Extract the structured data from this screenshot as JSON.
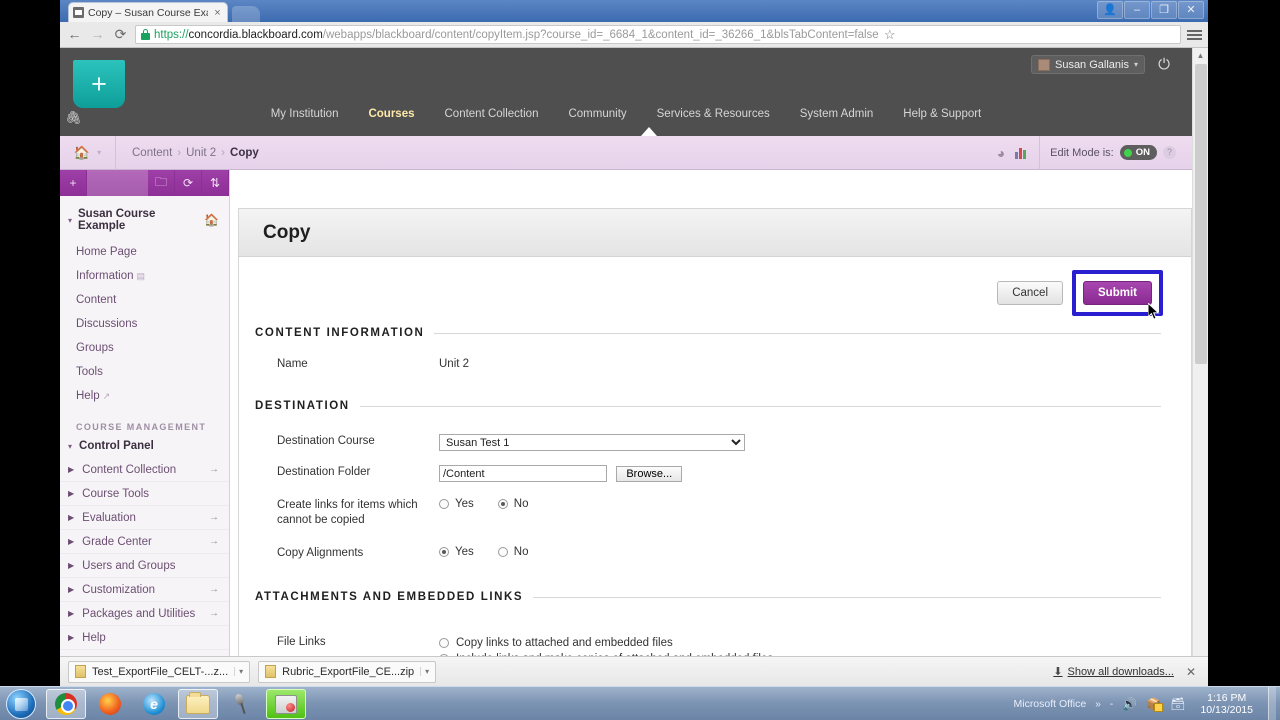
{
  "browser": {
    "tab": {
      "title": "Copy – Susan Course Exa",
      "close_label": "×",
      "favicon": "blackboard-favicon"
    },
    "window_controls": {
      "minimize": "–",
      "maximize": "❐",
      "close": "✕",
      "user": "👤"
    },
    "nav": {
      "back": "←",
      "forward": "→",
      "reload": "⟳"
    },
    "url": {
      "scheme": "https://",
      "host": "concordia.blackboard.com",
      "path": "/webapps/blackboard/content/copyItem.jsp?course_id=_6684_1&content_id=_36266_1&blsTabContent=false",
      "secure_label": "Secure"
    },
    "bookmark_star": "☆",
    "menu": "hamburger-menu"
  },
  "blackboard": {
    "logo_glyph": "+",
    "clip_glyph": "🖇",
    "user": {
      "name": "Susan Gallanis",
      "caret": "▾"
    },
    "power": "⏻",
    "nav_items": [
      {
        "label": "My Institution",
        "active": false
      },
      {
        "label": "Courses",
        "active": true
      },
      {
        "label": "Content Collection",
        "active": false
      },
      {
        "label": "Community",
        "active": false
      },
      {
        "label": "Services & Resources",
        "active": false
      },
      {
        "label": "System Admin",
        "active": false
      },
      {
        "label": "Help & Support",
        "active": false
      }
    ]
  },
  "breadcrumb": {
    "home_icon": "🏠",
    "home_caret": "▾",
    "items": [
      {
        "label": "Content",
        "current": false
      },
      {
        "label": "Unit 2",
        "current": false
      },
      {
        "label": "Copy",
        "current": true
      }
    ],
    "separator": "›",
    "edit_mode_label": "Edit Mode is:",
    "edit_mode_value": "ON",
    "help_glyph": "?"
  },
  "sidebar": {
    "toolbar": [
      {
        "name": "add-item",
        "glyph": "+"
      },
      {
        "name": "list-view",
        "glyph": "🗀"
      },
      {
        "name": "refresh",
        "glyph": "⟳"
      },
      {
        "name": "reorder",
        "glyph": "⇅"
      }
    ],
    "course_title": "Susan Course Example",
    "twisty": "▾",
    "home_glyph": "🏠",
    "links": [
      {
        "label": "Home Page",
        "ext": ""
      },
      {
        "label": "Information",
        "ext": "▤"
      },
      {
        "label": "Content",
        "ext": ""
      },
      {
        "label": "Discussions",
        "ext": ""
      },
      {
        "label": "Groups",
        "ext": ""
      },
      {
        "label": "Tools",
        "ext": ""
      },
      {
        "label": "Help",
        "ext": "↗"
      }
    ],
    "section_label": "COURSE MANAGEMENT",
    "control_panel_label": "Control Panel",
    "control_panel_items": [
      {
        "label": "Content Collection",
        "arrow": "→"
      },
      {
        "label": "Course Tools",
        "arrow": ""
      },
      {
        "label": "Evaluation",
        "arrow": "→"
      },
      {
        "label": "Grade Center",
        "arrow": "→"
      },
      {
        "label": "Users and Groups",
        "arrow": ""
      },
      {
        "label": "Customization",
        "arrow": "→"
      },
      {
        "label": "Packages and Utilities",
        "arrow": "→"
      },
      {
        "label": "Help",
        "arrow": ""
      }
    ],
    "item_twisty": "▶"
  },
  "page": {
    "title": "Copy",
    "cancel_label": "Cancel",
    "submit_label": "Submit",
    "highlight_color": "#2a1fd0",
    "sections": {
      "content_information": {
        "heading": "CONTENT INFORMATION",
        "name_label": "Name",
        "name_value": "Unit 2"
      },
      "destination": {
        "heading": "DESTINATION",
        "course_label": "Destination Course",
        "course_value": "Susan Test 1",
        "course_options": [
          "Susan Test 1"
        ],
        "folder_label": "Destination Folder",
        "folder_value": "/Content",
        "browse_label": "Browse...",
        "create_links_label": "Create links for items which cannot be copied",
        "create_links_yes": "Yes",
        "create_links_no": "No",
        "create_links_selected": "No",
        "copy_alignments_label": "Copy Alignments",
        "copy_alignments_yes": "Yes",
        "copy_alignments_no": "No",
        "copy_alignments_selected": "Yes"
      },
      "attachments": {
        "heading": "ATTACHMENTS AND EMBEDDED LINKS",
        "file_links_label": "File Links",
        "option_1": "Copy links to attached and embedded files",
        "option_2": "Include links and make copies of attached and embedded files",
        "selected": "option_2"
      }
    }
  },
  "downloads": {
    "items": [
      {
        "name": "Test_ExportFile_CELT-...z...",
        "caret": "▾"
      },
      {
        "name": "Rubric_ExportFile_CE...zip",
        "caret": "▾"
      }
    ],
    "show_all_label": "Show all downloads...",
    "show_all_icon": "⬇",
    "close_label": "✕"
  },
  "taskbar": {
    "start_label": "start-orb",
    "apps": [
      {
        "name": "chrome",
        "state": "active"
      },
      {
        "name": "firefox",
        "state": "normal"
      },
      {
        "name": "internet-explorer",
        "state": "normal"
      },
      {
        "name": "file-explorer",
        "state": "active"
      },
      {
        "name": "microphone",
        "state": "normal"
      },
      {
        "name": "paint",
        "state": "highlighted"
      }
    ],
    "tray_label": "Microsoft Office",
    "tray_chevron": "»",
    "tray_dash": "-",
    "volume_icon": "🔊",
    "network_icon": "📶",
    "action_icon": "🗔",
    "time": "1:16 PM",
    "date": "10/13/2015"
  }
}
